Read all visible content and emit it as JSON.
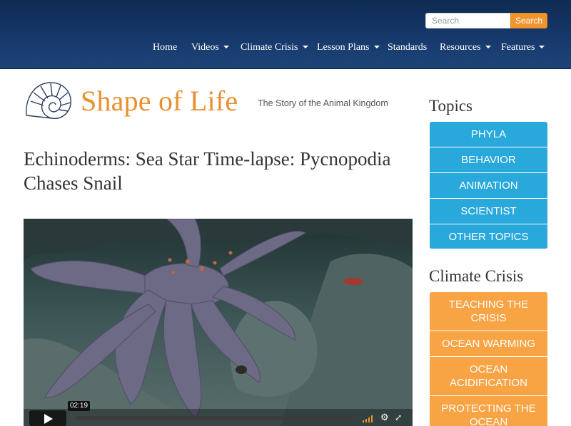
{
  "search": {
    "placeholder": "Search",
    "button_label": "Search"
  },
  "nav": {
    "items": [
      {
        "label": "Home",
        "dropdown": false
      },
      {
        "label": "Videos",
        "dropdown": true
      },
      {
        "label": "Climate Crisis",
        "dropdown": true
      },
      {
        "label": "Lesson Plans",
        "dropdown": true
      },
      {
        "label": "Standards",
        "dropdown": false
      },
      {
        "label": "Resources",
        "dropdown": true
      },
      {
        "label": "Features",
        "dropdown": true
      }
    ]
  },
  "logo": {
    "title": "Shape of Life",
    "tagline": "The Story of the Animal Kingdom"
  },
  "page": {
    "title": "Echinoderms: Sea Star Time-lapse: Pycnopodia Chases Snail"
  },
  "video": {
    "time": "02:19",
    "progress": 0.0
  },
  "sidebar": {
    "topics_heading": "Topics",
    "topics": [
      "PHYLA",
      "BEHAVIOR",
      "ANIMATION",
      "SCIENTIST",
      "OTHER TOPICS"
    ],
    "climate_heading": "Climate Crisis",
    "climate": [
      "TEACHING THE CRISIS",
      "OCEAN WARMING",
      "OCEAN ACIDIFICATION",
      "PROTECTING THE OCEAN"
    ]
  },
  "colors": {
    "header_bg": "#16396b",
    "brand_orange": "#e8902f",
    "topic_blue": "#29a8dc",
    "climate_orange": "#f8a344",
    "search_button": "#f0952e"
  },
  "icons": [
    "nautilus-shell-icon",
    "play-icon",
    "volume-icon",
    "gear-icon",
    "fullscreen-icon",
    "caret-down-icon"
  ]
}
